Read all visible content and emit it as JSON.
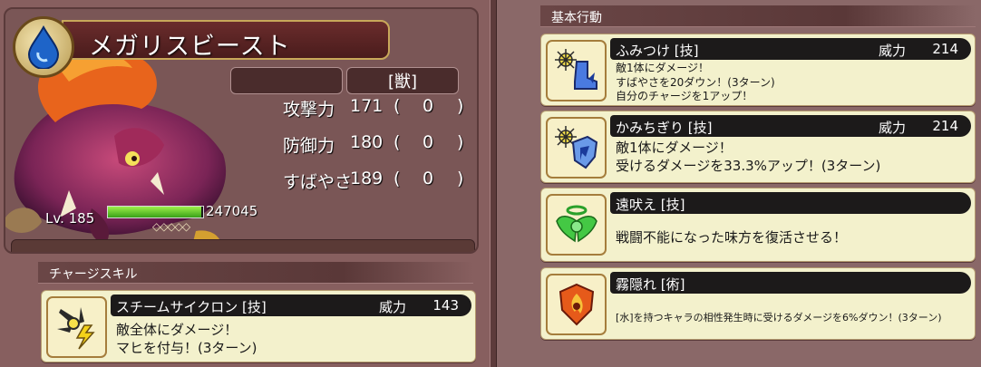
{
  "monster": {
    "name": "メガリスビースト",
    "type_badge": "",
    "family": "[獣]",
    "level": "Lv. 185",
    "hp": "247045",
    "hp_fill_fraction": 0.98,
    "awakening_marks": "◇◇◇◇◇",
    "element_icon": "water-drop-icon"
  },
  "stats": [
    {
      "label": "攻撃力",
      "value": "171",
      "paren_open": "(",
      "mod": "0",
      "paren_close": ")"
    },
    {
      "label": "防御力",
      "value": "180",
      "paren_open": "(",
      "mod": "0",
      "paren_close": ")"
    },
    {
      "label": "すばやさ",
      "value": "189",
      "paren_open": "(",
      "mod": "0",
      "paren_close": ")"
    }
  ],
  "charge_section": {
    "header": "チャージスキル",
    "skill": {
      "name": "スチームサイクロン [技]",
      "power_label": "威力",
      "power": "143",
      "desc_lines": [
        "敵全体にダメージ！",
        "マヒを付与！(3ターン)"
      ],
      "icon": "shuriken-lightning-icon"
    }
  },
  "basic_section": {
    "header": "基本行動",
    "skills": [
      {
        "name": "ふみつけ [技]",
        "power_label": "威力",
        "power": "214",
        "desc_lines": [
          "敵1体にダメージ！",
          "すばやさを20ダウン！(3ターン)",
          "自分のチャージを1アップ！"
        ],
        "icon": "stomp-boot-icon"
      },
      {
        "name": "かみちぎり [技]",
        "power_label": "威力",
        "power": "214",
        "desc_lines": [
          "敵1体にダメージ！",
          "受けるダメージを33.3%アップ！(3ターン)"
        ],
        "icon": "shield-break-icon"
      },
      {
        "name": "遠吠え [技]",
        "power_label": "",
        "power": "",
        "desc_lines": [
          "戦闘不能になった味方を復活させる！"
        ],
        "icon": "angel-wings-icon"
      },
      {
        "name": "霧隠れ [術]",
        "power_label": "",
        "power": "",
        "desc_lines": [
          "[水]を持つキャラの相性発生時に受けるダメージを6%ダウン！(3ターン)"
        ],
        "icon": "flame-shield-icon"
      }
    ]
  },
  "colors": {
    "panel_bg": "#875f5f",
    "card_bg": "#f3f1cc",
    "hp_green": "#38a018",
    "name_border": "#c8a85a"
  }
}
